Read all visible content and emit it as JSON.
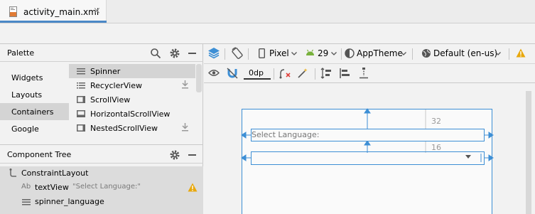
{
  "editor_tab": {
    "title": "activity_main.xml",
    "close": "×"
  },
  "palette": {
    "title": "Palette",
    "categories": [
      "Widgets",
      "Layouts",
      "Containers",
      "Google"
    ],
    "selected_category": "Containers",
    "items": [
      {
        "label": "Spinner"
      },
      {
        "label": "RecyclerView"
      },
      {
        "label": "ScrollView"
      },
      {
        "label": "HorizontalScrollView"
      },
      {
        "label": "NestedScrollView"
      }
    ]
  },
  "component_tree": {
    "title": "Component Tree",
    "root": "ConstraintLayout",
    "text_view": {
      "badge": "Ab",
      "name": "textView",
      "text": "\"Select Language:\""
    },
    "spinner": {
      "name": "spinner_language"
    }
  },
  "design_toolbar": {
    "device": "Pixel",
    "api_level": "29",
    "theme": "AppTheme",
    "locale": "Default (en-us)",
    "default_margin": "0dp"
  },
  "canvas": {
    "text_view_text": "Select Language:",
    "margin_top": "32",
    "margin_spinner_top": "16"
  },
  "colors": {
    "blueprint": "#3d8fd5",
    "warning": "#e8a80d",
    "android_green": "#78b13c"
  }
}
